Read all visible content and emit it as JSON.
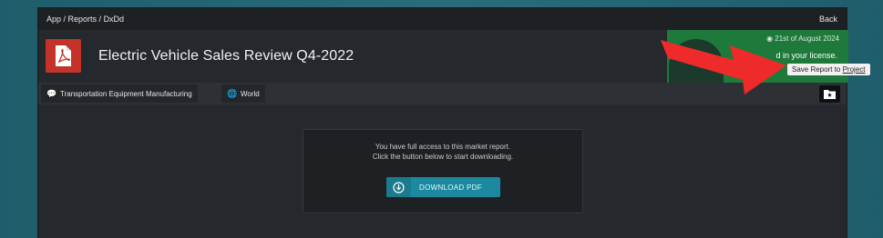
{
  "breadcrumb": {
    "app": "App",
    "sep1": " / ",
    "reports": "Reports",
    "sep2": " / ",
    "current": "DxDd"
  },
  "topbar": {
    "back_label": "Back"
  },
  "report": {
    "title": "Electric Vehicle Sales Review Q4-2022",
    "date": "21st of August 2024",
    "license_text": "d in your license."
  },
  "tooltip": {
    "prefix": "Save Report to ",
    "link": "Project"
  },
  "tags": [
    {
      "label": "Transportation Equipment Manufacturing",
      "icon": "chat-icon"
    },
    {
      "label": "World",
      "icon": "globe-icon"
    }
  ],
  "card": {
    "line1": "You have full access to this market report.",
    "line2": "Click the button below to start downloading.",
    "button_label": "DOWNLOAD PDF"
  },
  "colors": {
    "accent": "#1b8aa0",
    "pdf_red": "#c4332a",
    "banner_green": "#1e7a3b",
    "arrow_red": "#ee2a2a"
  }
}
